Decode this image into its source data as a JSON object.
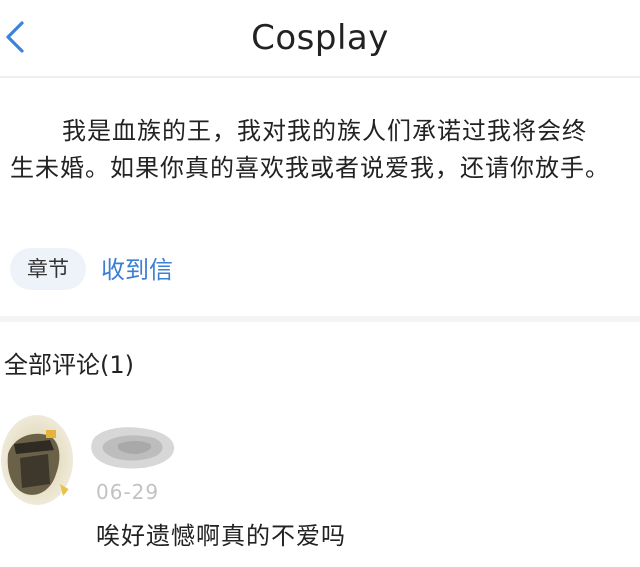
{
  "header": {
    "title": "Cosplay",
    "back_icon": "chevron-left-icon",
    "accent_color": "#3b82d9"
  },
  "post": {
    "body": "我是血族的王，我对我的族人们承诺过我将会终生未婚。如果你真的喜欢我或者说爱我，还请你放手。"
  },
  "chapter": {
    "tag_label": "章节",
    "name": "收到信",
    "link_color": "#3b7fd3"
  },
  "comments": {
    "header": "全部评论(1)",
    "items": [
      {
        "date": "06-29",
        "text": "唉好遗憾啊真的不爱吗"
      }
    ]
  }
}
